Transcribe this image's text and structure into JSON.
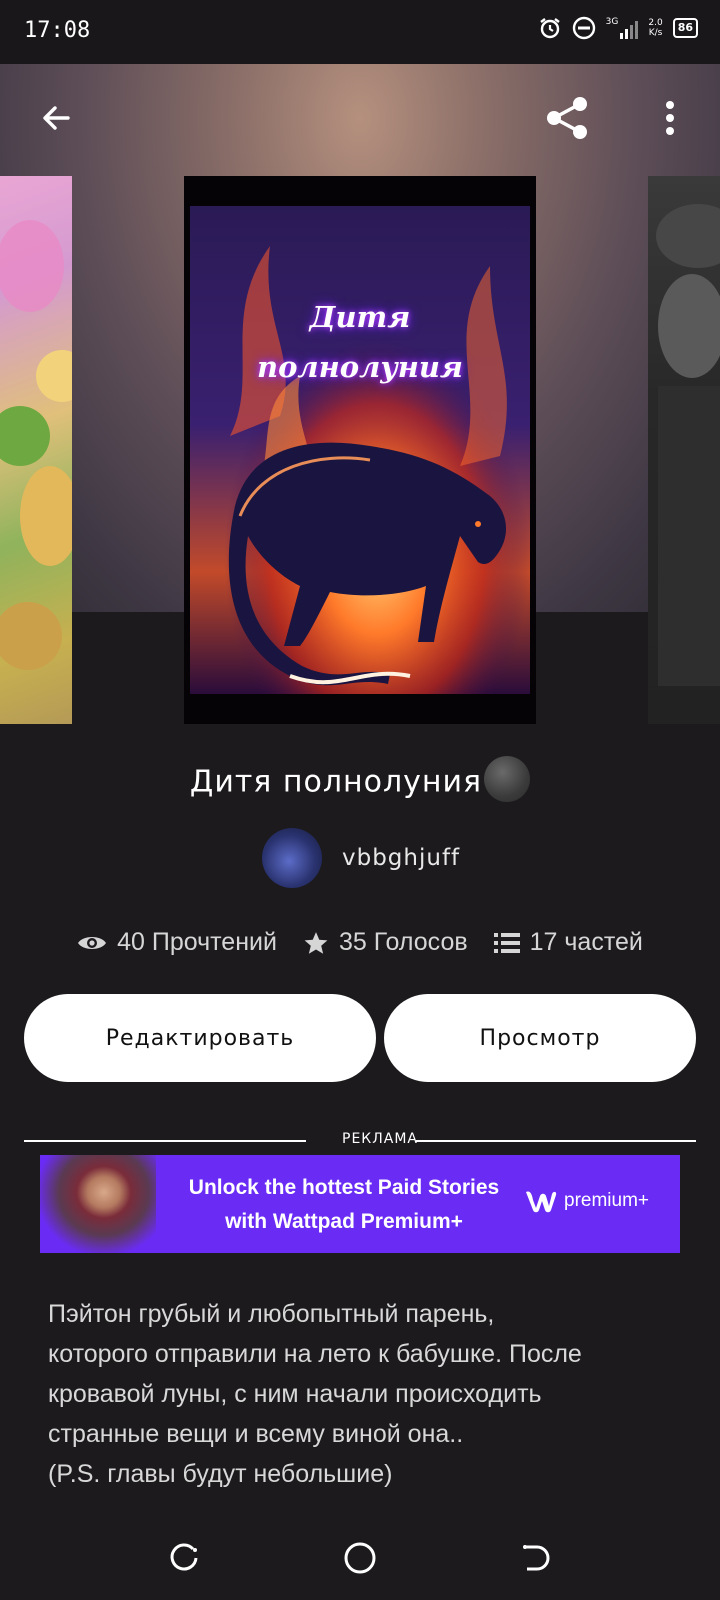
{
  "status_bar": {
    "time": "17:08",
    "network_type": "3G",
    "net_speed_value": "2.0",
    "net_speed_unit": "K/s",
    "battery": "86"
  },
  "top_bar": {
    "back_icon": "arrow-left-icon",
    "share_icon": "share-icon",
    "menu_icon": "more-vertical-icon"
  },
  "cover": {
    "title_line1": "Дитя",
    "title_line2": "полнолуния"
  },
  "story": {
    "title": "Дитя полнолуния",
    "title_emoji": "new-moon-face-icon",
    "author": "vbbghjuff",
    "stats": {
      "reads": "40 Прочтений",
      "votes": "35 Голосов",
      "parts": "17 частей"
    }
  },
  "actions": {
    "edit_label": "Редактировать",
    "view_label": "Просмотр"
  },
  "ad": {
    "label": "РЕКЛАМА",
    "line1": "Unlock the hottest Paid Stories",
    "line2": "with Wattpad Premium+",
    "logo_text": "premium+"
  },
  "description": {
    "lines": [
      "Пэйтон грубый и любопытный парень,",
      "которого отправили на лето к бабушке. После",
      "кровавой луны, с ним начали происходить",
      "странные вещи и всему виной она..",
      "(P.S. главы будут небольшие)"
    ]
  },
  "colors": {
    "background": "#1c1a1d",
    "ad_purple": "#6a2cf5",
    "button_bg": "#ffffff"
  }
}
